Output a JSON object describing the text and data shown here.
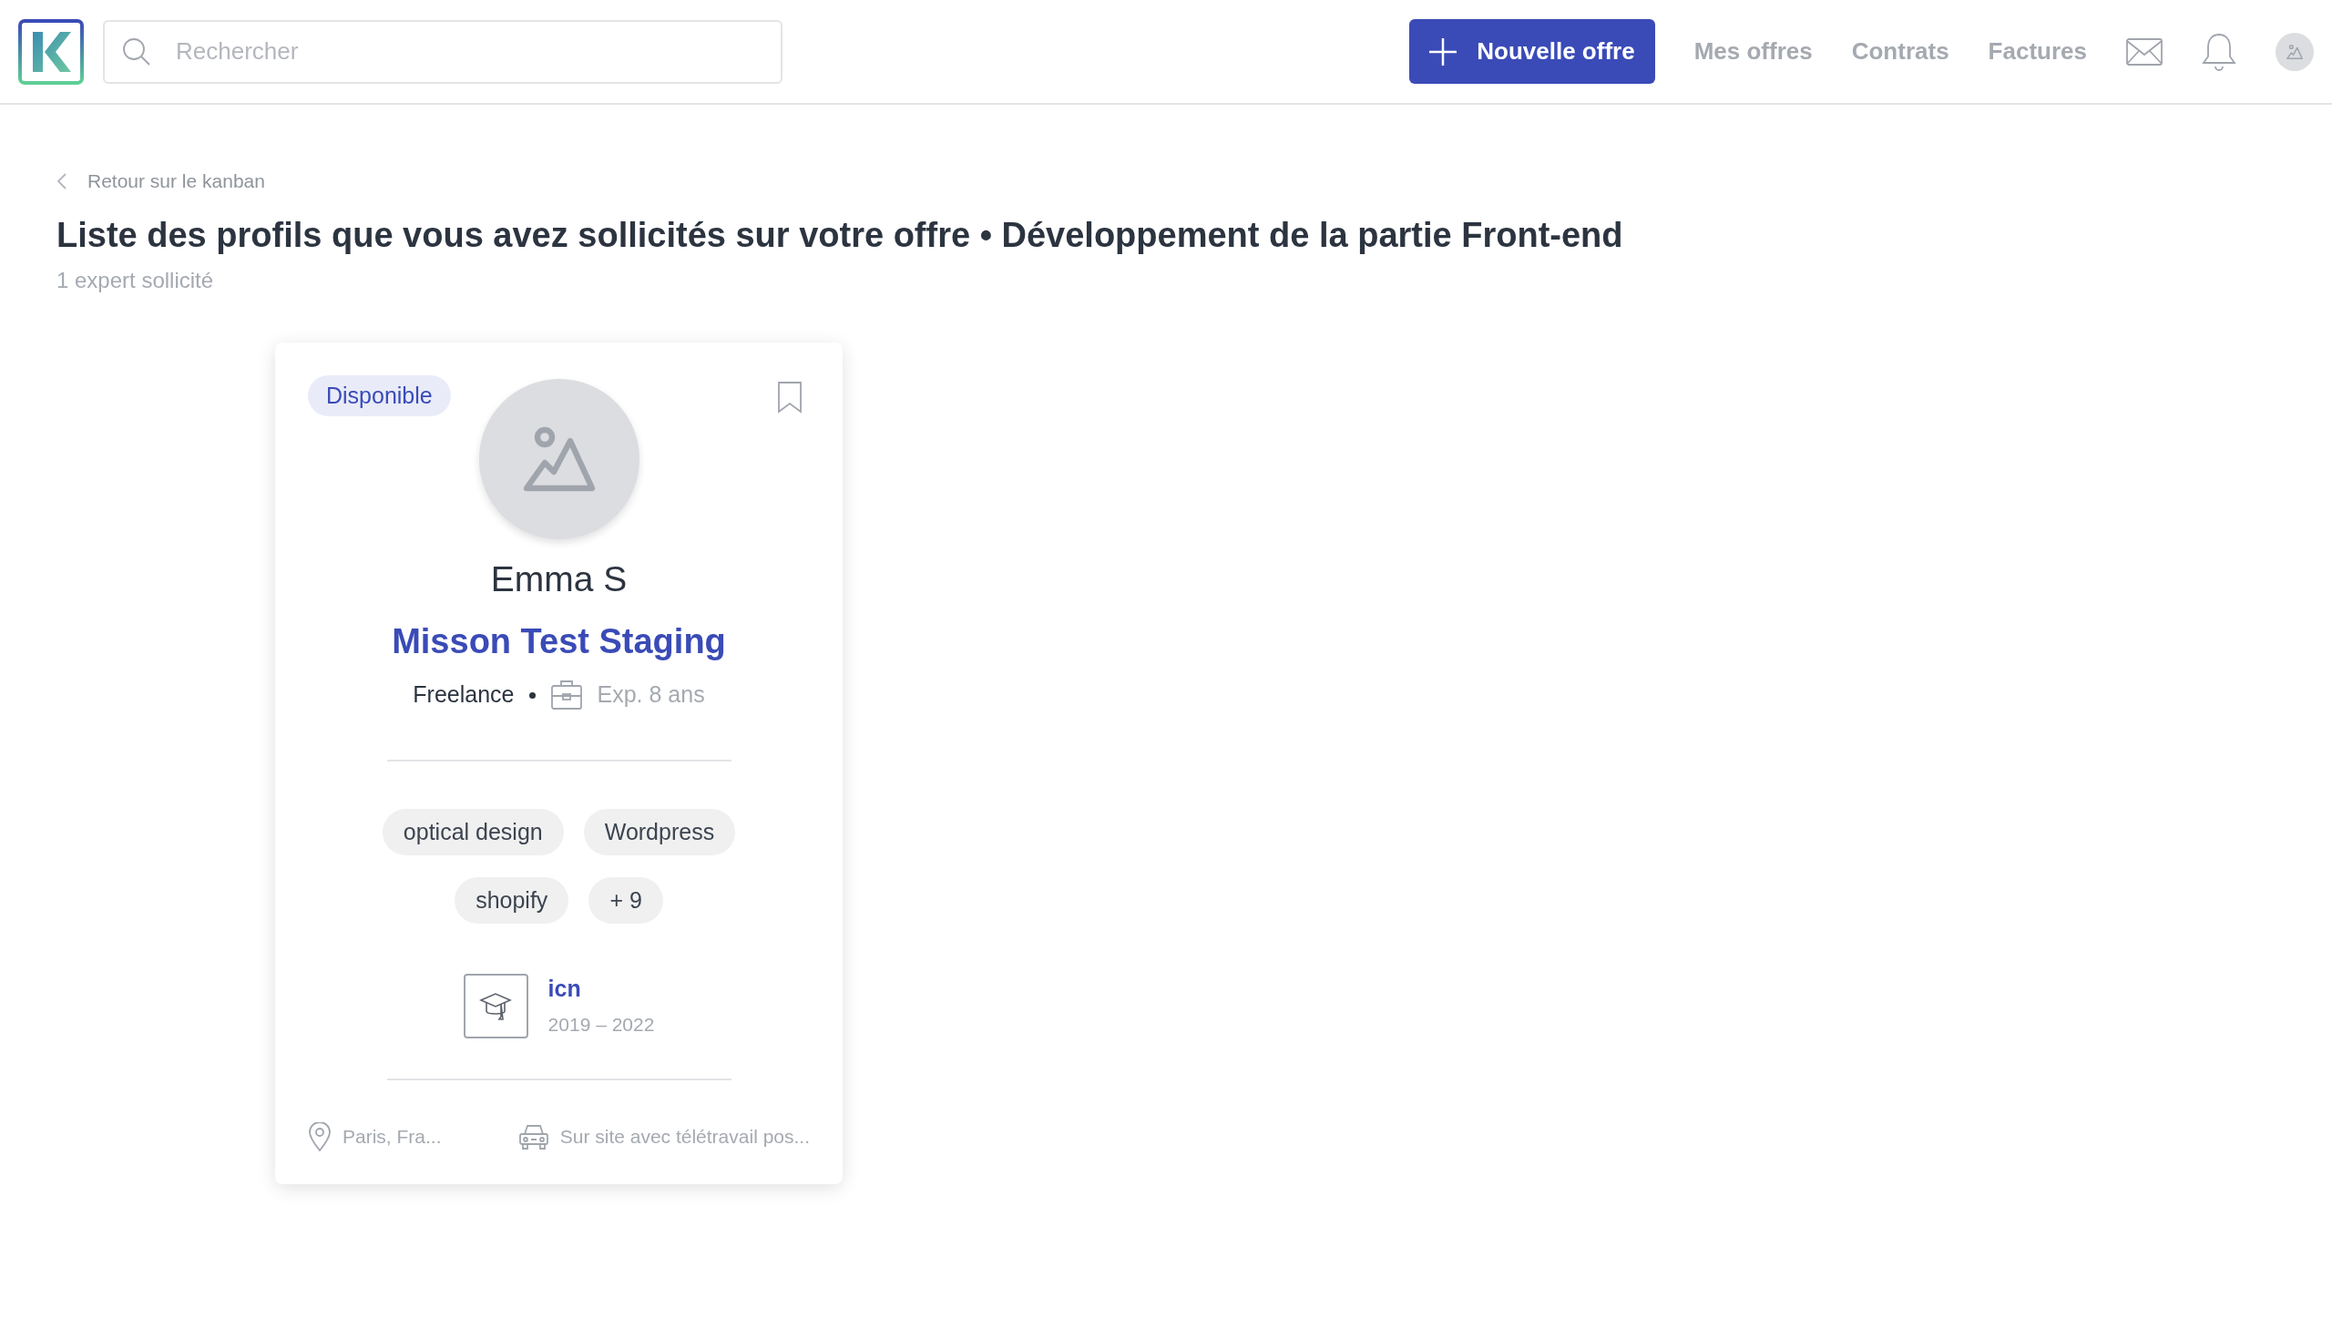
{
  "header": {
    "search": {
      "placeholder": "Rechercher"
    },
    "new_offer_button": "Nouvelle offre",
    "nav": [
      "Mes offres",
      "Contrats",
      "Factures"
    ]
  },
  "back_link": "Retour sur le kanban",
  "title": "Liste des profils que vous avez sollicités sur votre offre • Développement de la partie Front-end",
  "subtitle": "1 expert sollicité",
  "profiles": [
    {
      "status": "Disponible",
      "name": "Emma S",
      "headline": "Misson Test Staging",
      "contract": "Freelance",
      "experience": "Exp. 8 ans",
      "skills": [
        "optical design",
        "Wordpress",
        "shopify",
        "+ 9"
      ],
      "education": {
        "school": "icn",
        "years": "2019 – 2022"
      },
      "location": "Paris, Fra...",
      "work_mode": "Sur site avec télétravail pos..."
    }
  ]
}
